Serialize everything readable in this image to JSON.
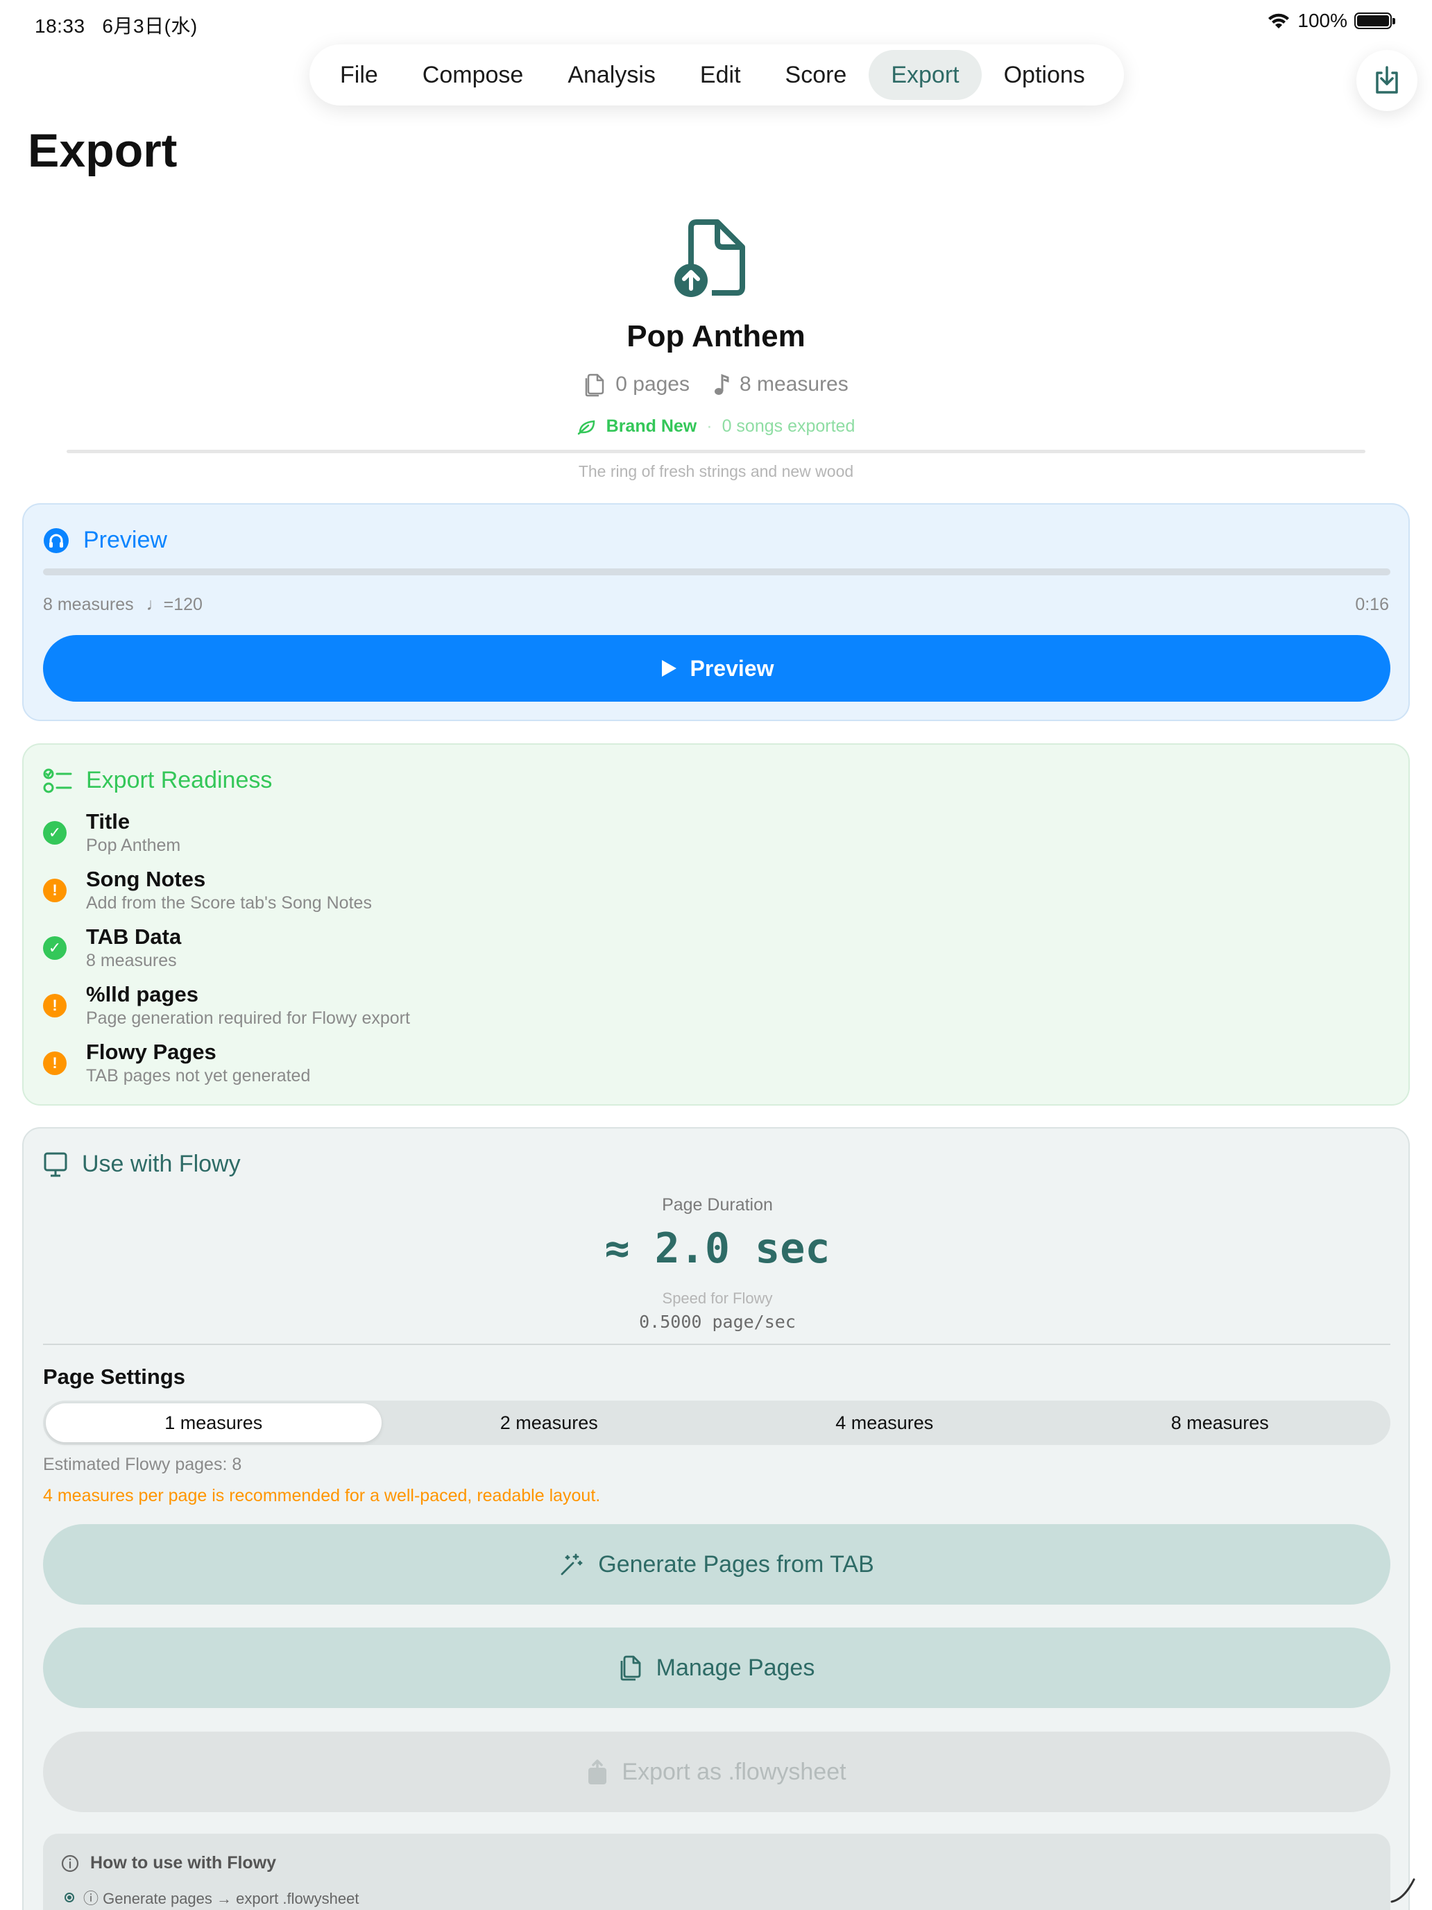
{
  "status_bar": {
    "time": "18:33",
    "date": "6月3日(水)",
    "battery": "100%"
  },
  "menu": {
    "items": [
      {
        "label": "File",
        "active": false
      },
      {
        "label": "Compose",
        "active": false
      },
      {
        "label": "Analysis",
        "active": false
      },
      {
        "label": "Edit",
        "active": false
      },
      {
        "label": "Score",
        "active": false
      },
      {
        "label": "Export",
        "active": true
      },
      {
        "label": "Options",
        "active": false
      }
    ]
  },
  "page": {
    "title": "Export"
  },
  "song": {
    "title": "Pop Anthem",
    "pages": "0 pages",
    "measures": "8 measures",
    "badge": "Brand New",
    "separator": "·",
    "exported": "0 songs exported",
    "tagline": "The ring of fresh strings and new wood"
  },
  "preview": {
    "heading": "Preview",
    "measures": "8 measures",
    "tempo": "♩=120",
    "duration": "0:16",
    "progress": 0,
    "button_label": "Preview"
  },
  "readiness": {
    "heading": "Export Readiness",
    "items": [
      {
        "title": "Title",
        "subtitle": "Pop Anthem",
        "status": "ok"
      },
      {
        "title": "Song Notes",
        "subtitle": "Add from the Score tab's Song Notes",
        "status": "warn"
      },
      {
        "title": "TAB Data",
        "subtitle": "8 measures",
        "status": "ok"
      },
      {
        "title": "%lld pages",
        "subtitle": "Page generation required for Flowy export",
        "status": "warn"
      },
      {
        "title": "Flowy Pages",
        "subtitle": "TAB pages not yet generated",
        "status": "warn"
      }
    ]
  },
  "flowy": {
    "heading": "Use with Flowy",
    "duration_label": "Page Duration",
    "duration_value": "≈ 2.0 sec",
    "speed_label": "Speed for Flowy",
    "speed_value": "0.5000 page/sec",
    "settings_title": "Page Settings",
    "segments": [
      "1 measures",
      "2 measures",
      "4 measures",
      "8 measures"
    ],
    "selected_segment": "1 measures",
    "estimated_pages": "Estimated Flowy pages: 8",
    "recommendation": "4 measures per page is recommended for a well-paced, readable layout.",
    "generate_label": "Generate Pages from TAB",
    "manage_label": "Manage Pages",
    "export_label": "Export as .flowysheet",
    "howto_title": "How to use with Flowy",
    "howto_step": "ⓘ Generate pages → export .flowysheet"
  },
  "colors": {
    "accent_teal": "#2e6b66",
    "preview_blue": "#0a84ff",
    "ok_green": "#34c759",
    "warn_orange": "#ff9500"
  },
  "icons": {
    "export_header": "tray-arrow-down-icon",
    "hero": "document-upload-icon",
    "pages": "pages-icon",
    "measures": "music-note-icon",
    "badge": "leaf-icon",
    "preview": "headphones-icon",
    "play": "play-icon",
    "readiness": "checklist-icon",
    "flowy": "monitor-icon",
    "generate": "magic-wand-icon",
    "manage": "pages-icon",
    "export": "share-icon",
    "info": "info-icon"
  }
}
